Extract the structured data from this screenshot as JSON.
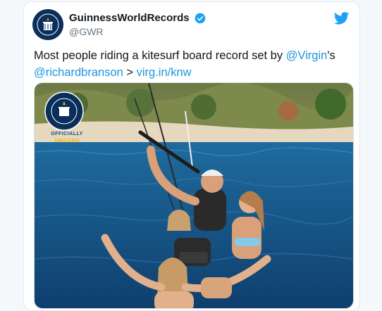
{
  "account": {
    "display_name": "GuinnessWorldRecords",
    "handle": "@GWR",
    "verified": true,
    "avatar_text": "GUINNESS WORLD RECORDS"
  },
  "tweet": {
    "text_before": "Most people riding a kitesurf board record set by ",
    "mention_1": "@Virgin",
    "text_middle": "'s ",
    "mention_2": "@richardbranson",
    "text_sep": " > ",
    "link": "virg.in/knw"
  },
  "media": {
    "badge_line1": "OFFICIALLY",
    "badge_line2": "AMAZING",
    "badge_ring_text": "GUINNESS WORLD RECORDS"
  },
  "colors": {
    "twitter_blue": "#1da1f2",
    "link_blue": "#1b95e0",
    "gwr_navy": "#0b2f5b"
  },
  "icons": [
    "verified-badge-icon",
    "twitter-bird-icon"
  ]
}
